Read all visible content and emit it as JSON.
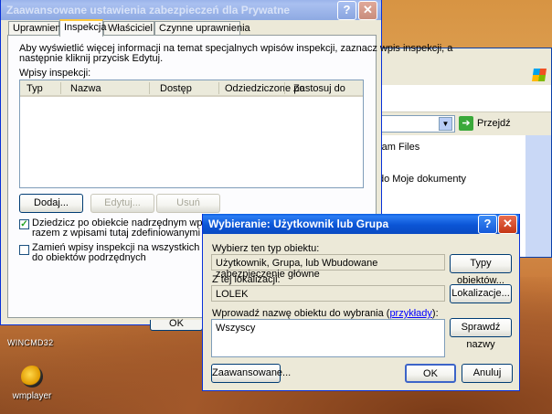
{
  "explorer": {
    "go_label": "Przejdź",
    "items": [
      "ram Files",
      "do Moje dokumenty"
    ]
  },
  "adv_dialog": {
    "title": "Zaawansowane ustawienia zabezpieczeń dla Prywatne",
    "tabs": [
      "Uprawnienia",
      "Inspekcja",
      "Właściciel",
      "Czynne uprawnienia"
    ],
    "active_tab": "Inspekcja",
    "info_text_1": "Aby wyświetlić więcej informacji na temat specjalnych wpisów inspekcji, zaznacz wpis inspekcji, a",
    "info_text_2": "następnie kliknij przycisk Edytuj.",
    "entries_label": "Wpisy inspekcji:",
    "columns": [
      "Typ",
      "Nazwa",
      "Dostęp",
      "Odziedziczone po",
      "Zastosuj do"
    ],
    "add_button": "Dodaj...",
    "edit_button": "Edytuj...",
    "remove_button": "Usuń",
    "inherit_check_1": "Dziedzicz po obiekcie nadrzędnym wpisy inspekcji sto",
    "inherit_check_2": "razem z wpisami tutaj zdefiniowanymi",
    "inherit_checked": true,
    "replace_check_1": "Zamień wpisy inspekcji na wszystkich obiektach podr",
    "replace_check_2": "do obiektów podrzędnych",
    "replace_checked": false,
    "ok_button": "OK"
  },
  "select_dialog": {
    "title": "Wybieranie: Użytkownik lub Grupa",
    "type_label": "Wybierz ten typ obiektu:",
    "type_value": "Użytkownik, Grupa, lub Wbudowane zabezpieczenie główne",
    "type_button": "Typy obiektów...",
    "location_label": "Z tej lokalizacji:",
    "location_value": "LOLEK",
    "location_button": "Lokalizacje...",
    "name_label_prefix": "Wprowadź nazwę obiektu do wybrania (",
    "name_label_link": "przykłady",
    "name_label_suffix": "):",
    "name_value": "Wszyscy",
    "check_names_button": "Sprawdź nazwy",
    "advanced_button": "Zaawansowane...",
    "ok_button": "OK",
    "cancel_button": "Anuluj"
  },
  "desktop": {
    "partial_label": "WINCMD32",
    "wmplayer_label": "wmplayer"
  },
  "colors": {
    "title_active": "#0a5ce0",
    "dialog_bg": "#ece9d8",
    "close_red": "#c43614"
  }
}
